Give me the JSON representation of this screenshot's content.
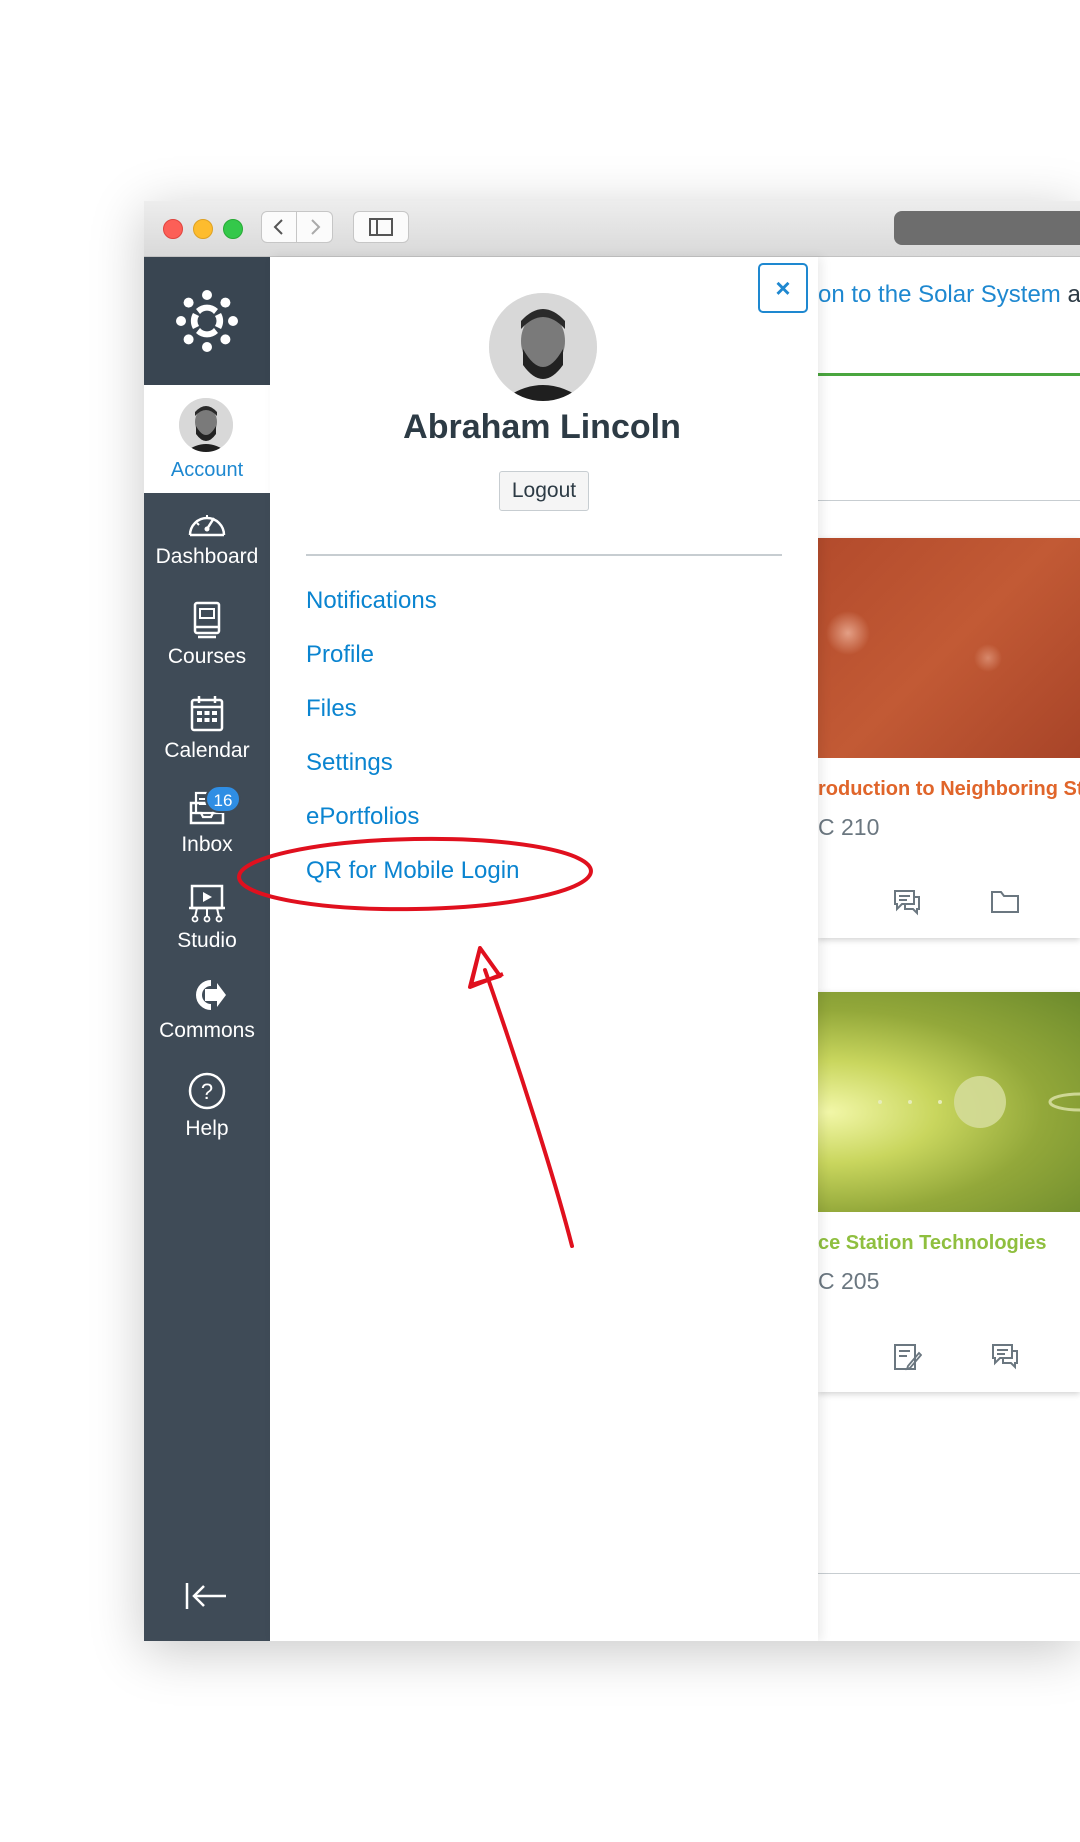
{
  "user": {
    "name": "Abraham Lincoln"
  },
  "global_nav": {
    "items": [
      {
        "label": "Account"
      },
      {
        "label": "Dashboard"
      },
      {
        "label": "Courses"
      },
      {
        "label": "Calendar"
      },
      {
        "label": "Inbox",
        "badge": "16"
      },
      {
        "label": "Studio"
      },
      {
        "label": "Commons"
      },
      {
        "label": "Help"
      }
    ]
  },
  "tray": {
    "logout_label": "Logout",
    "links": [
      {
        "label": "Notifications"
      },
      {
        "label": "Profile"
      },
      {
        "label": "Files"
      },
      {
        "label": "Settings"
      },
      {
        "label": "ePortfolios"
      },
      {
        "label": "QR for Mobile Login"
      }
    ],
    "close_label": "×"
  },
  "content": {
    "banner": {
      "link_text": "on to the Solar System",
      "trailing_text": " as a"
    },
    "cards": [
      {
        "title": "roduction to Neighboring Sta",
        "subtitle": "C 210",
        "title_color": "#e0652a"
      },
      {
        "title": "ce Station Technologies",
        "subtitle": "C 205",
        "title_color": "#8fbf3f"
      }
    ]
  },
  "colors": {
    "nav_background": "#3f4b57",
    "link_blue": "#0a84d0",
    "annotation_red": "#e0101e"
  }
}
